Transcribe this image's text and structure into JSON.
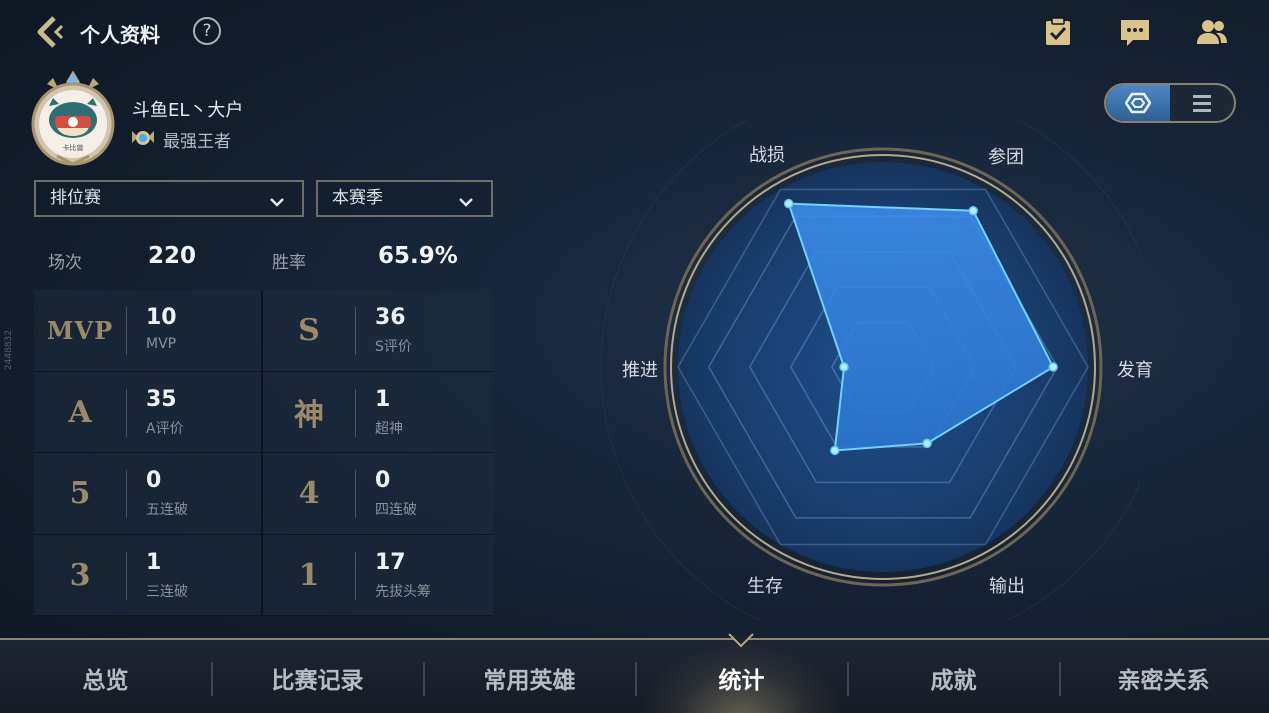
{
  "header": {
    "title": "个人资料",
    "help": "?",
    "icons": [
      "back-arrow-icon",
      "help-icon",
      "task-checklist-icon",
      "chat-icon",
      "friends-icon"
    ]
  },
  "profile": {
    "name": "斗鱼EL丶大户",
    "rank": "最强王者",
    "avatar_caption": "卡比兽"
  },
  "filters": {
    "mode": "排位赛",
    "season": "本赛季"
  },
  "summary": {
    "matches_label": "场次",
    "matches_value": "220",
    "winrate_label": "胜率",
    "winrate_value": "65.9%"
  },
  "stats": [
    {
      "glyph": "MVP",
      "value": "10",
      "label": "MVP"
    },
    {
      "glyph": "S",
      "value": "36",
      "label": "S评价"
    },
    {
      "glyph": "A",
      "value": "35",
      "label": "A评价"
    },
    {
      "glyph": "神",
      "value": "1",
      "label": "超神"
    },
    {
      "glyph": "5",
      "value": "0",
      "label": "五连破"
    },
    {
      "glyph": "4",
      "value": "0",
      "label": "四连破"
    },
    {
      "glyph": "3",
      "value": "1",
      "label": "三连破"
    },
    {
      "glyph": "1",
      "value": "17",
      "label": "先拔头筹"
    }
  ],
  "side_id": "2448832",
  "radar": {
    "labels": {
      "zhansun": "战损",
      "cantuan": "参团",
      "fayu": "发育",
      "shuchu": "输出",
      "shengcun": "生存",
      "tuijin": "推进"
    },
    "values": {
      "zhansun": 0.92,
      "cantuan": 0.88,
      "fayu": 0.83,
      "shuchu": 0.43,
      "shengcun": 0.47,
      "tuijin": 0.19
    },
    "accent": "#5fc8ff"
  },
  "view_toggle": {
    "active": "radar-view-icon",
    "inactive": "list-view-icon"
  },
  "nav": {
    "items": [
      "总览",
      "比赛记录",
      "常用英雄",
      "统计",
      "成就",
      "亲密关系"
    ],
    "active_index": 3
  },
  "colors": {
    "gold": "#9a8a6b",
    "border_gold": "#8f856a",
    "radar_fill": "#2f7fd6"
  }
}
